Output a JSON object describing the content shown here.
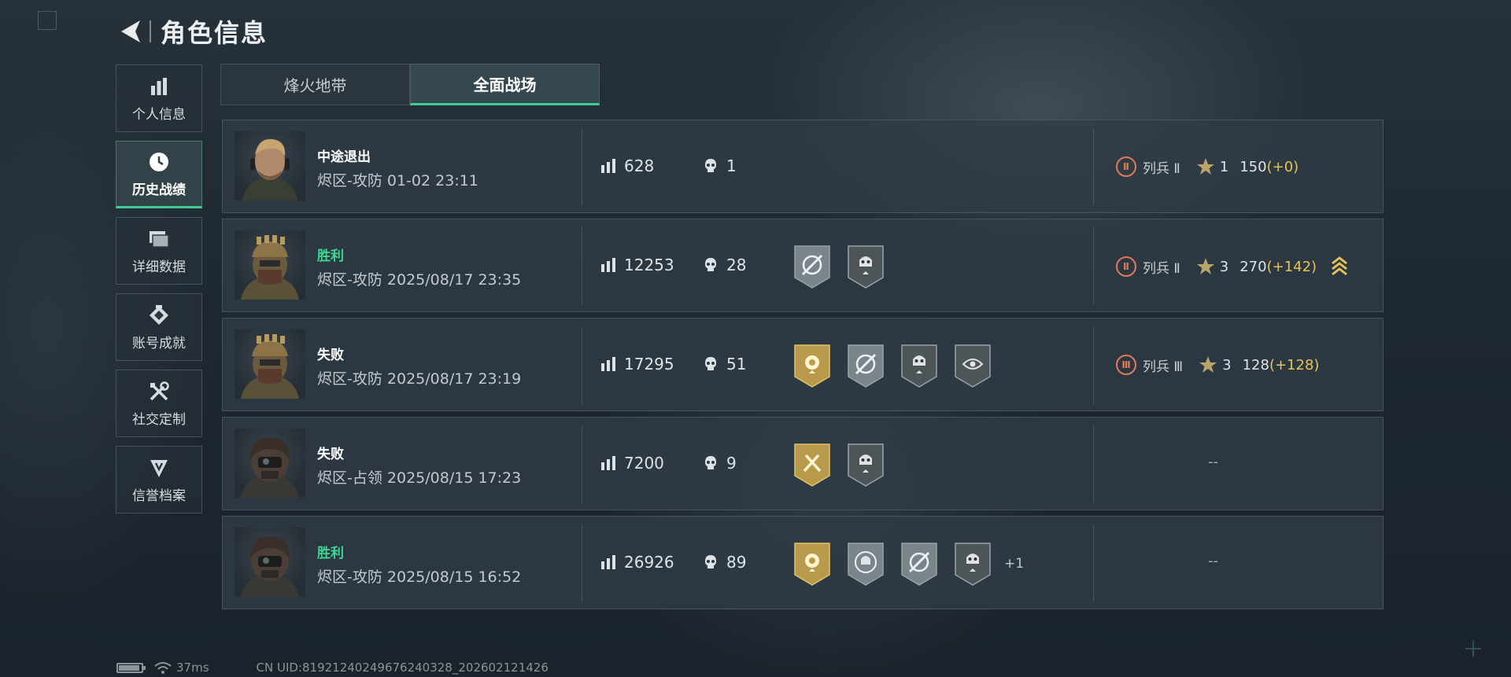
{
  "header": {
    "title": "角色信息"
  },
  "sidebar": {
    "items": [
      {
        "label": "个人信息",
        "icon": "bar-chart-icon",
        "active": false
      },
      {
        "label": "历史战绩",
        "icon": "clock-icon",
        "active": true
      },
      {
        "label": "详细数据",
        "icon": "folders-icon",
        "active": false
      },
      {
        "label": "账号成就",
        "icon": "achievement-icon",
        "active": false
      },
      {
        "label": "社交定制",
        "icon": "tools-icon",
        "active": false
      },
      {
        "label": "信誉档案",
        "icon": "reputation-icon",
        "active": false
      }
    ]
  },
  "tabs": [
    {
      "label": "烽火地带",
      "active": false
    },
    {
      "label": "全面战场",
      "active": true
    }
  ],
  "matches": [
    {
      "result": "中途退出",
      "result_type": "quit",
      "mode": "烬区-攻防 01-02 23:11",
      "score": "628",
      "kills": "1",
      "badges": [],
      "extra": "",
      "rank": {
        "roman": "Ⅱ",
        "name": "列兵 Ⅱ",
        "stars": "1",
        "points": "150",
        "delta": "(+0)",
        "rank_up": false
      }
    },
    {
      "result": "胜利",
      "result_type": "win",
      "mode": "烬区-攻防 2025/08/17 23:35",
      "score": "12253",
      "kills": "28",
      "badges": [
        "crosshair-badge",
        "skull-badge"
      ],
      "extra": "",
      "rank": {
        "roman": "Ⅱ",
        "name": "列兵 Ⅱ",
        "stars": "3",
        "points": "270",
        "delta": "(+142)",
        "rank_up": true
      }
    },
    {
      "result": "失败",
      "result_type": "loss",
      "mode": "烬区-攻防 2025/08/17 23:19",
      "score": "17295",
      "kills": "51",
      "badges": [
        "gold-flower-badge",
        "crosshair-badge",
        "skull-badge",
        "eye-badge"
      ],
      "extra": "",
      "rank": {
        "roman": "Ⅲ",
        "name": "列兵 Ⅲ",
        "stars": "3",
        "points": "128",
        "delta": "(+128)",
        "rank_up": false
      }
    },
    {
      "result": "失败",
      "result_type": "loss",
      "mode": "烬区-占领 2025/08/15 17:23",
      "score": "7200",
      "kills": "9",
      "badges": [
        "gold-axes-badge",
        "skull-badge"
      ],
      "extra": "",
      "rank": null,
      "empty_rank": "--"
    },
    {
      "result": "胜利",
      "result_type": "win",
      "mode": "烬区-攻防 2025/08/15 16:52",
      "score": "26926",
      "kills": "89",
      "badges": [
        "gold-flower-badge",
        "skull-circle-badge",
        "crosshair-badge",
        "skull-badge"
      ],
      "extra": "+1",
      "rank": null,
      "empty_rank": "--"
    }
  ],
  "footer": {
    "ping": "37ms",
    "uid": "CN UID:8192124024967624032​8_202602121426",
    "battery_level": 0.85
  },
  "colors": {
    "accent": "#3fcf94",
    "win": "#3fd694",
    "gold": "#e6c25a",
    "rank": "#e07b5a"
  }
}
